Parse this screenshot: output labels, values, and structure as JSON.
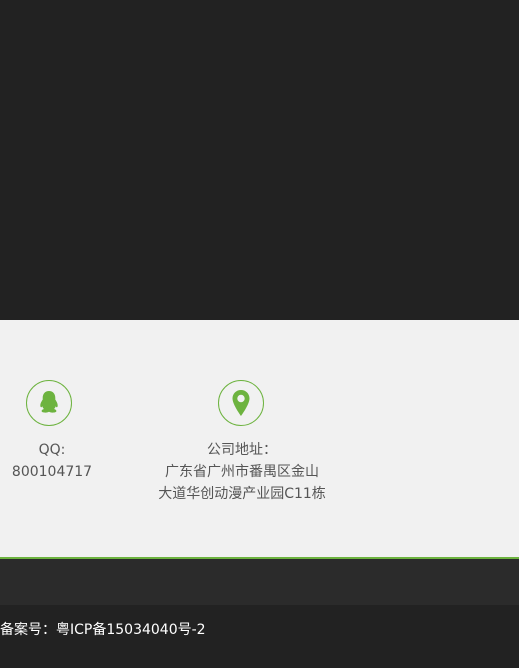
{
  "contact": {
    "qq": {
      "icon": "qq-penguin-icon",
      "label": "QQ:",
      "value": "800104717"
    },
    "address": {
      "icon": "location-pin-icon",
      "label": "公司地址：",
      "line1": "广东省广州市番禺区金山",
      "line2": "大道华创动漫产业园C11栋"
    }
  },
  "footer": {
    "icp": "备案号：粤ICP备15034040号-2"
  },
  "colors": {
    "accent": "#6db33f",
    "dark_bg": "#222222",
    "light_band": "#f1f1f1",
    "text_gray": "#555555"
  }
}
